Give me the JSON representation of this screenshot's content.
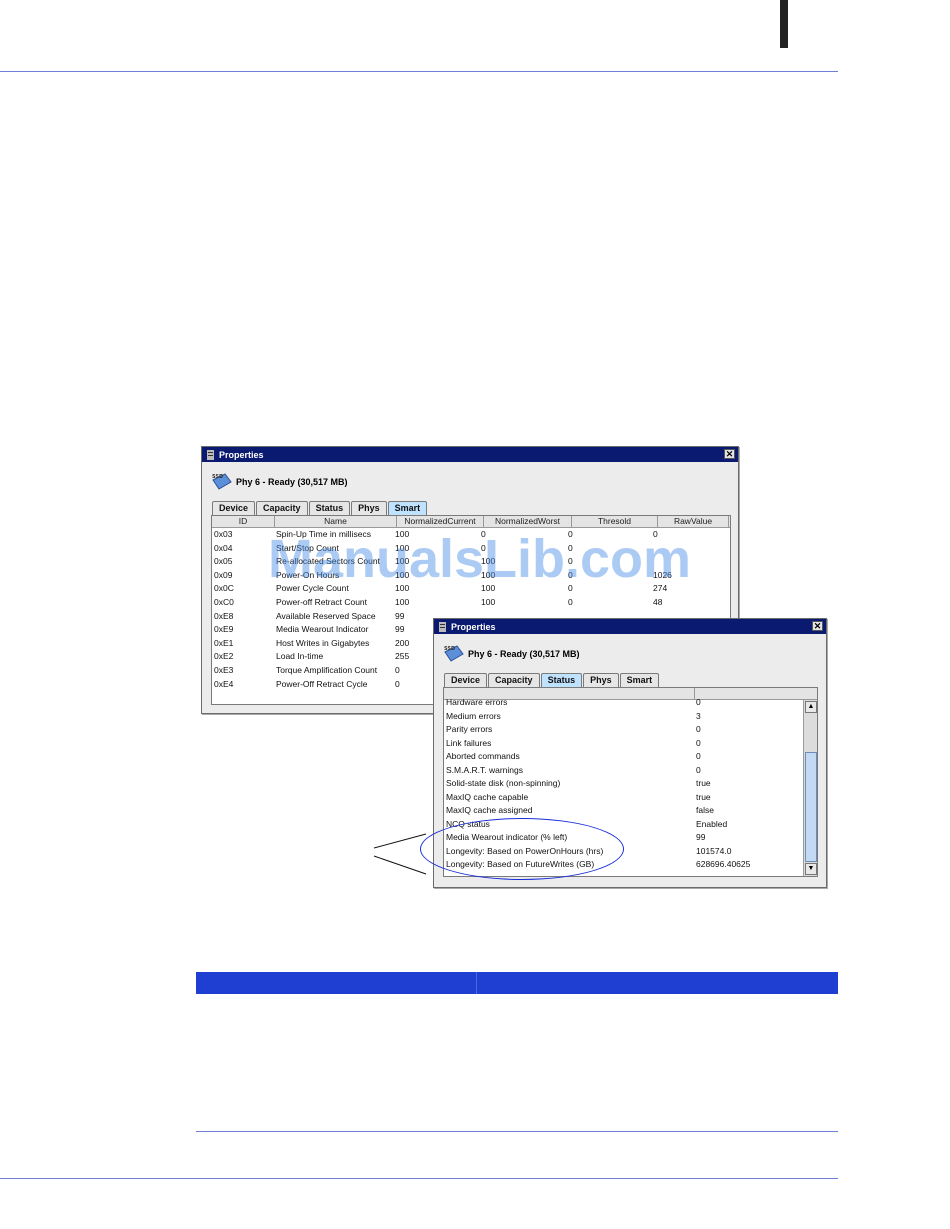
{
  "page": {
    "watermark": "ManualsLib.com"
  },
  "window1": {
    "title": "Properties",
    "close_glyph": "✕",
    "device_label": "Phy 6 - Ready (30,517 MB)",
    "tabs": [
      {
        "label": "Device",
        "active": false
      },
      {
        "label": "Capacity",
        "active": false
      },
      {
        "label": "Status",
        "active": false
      },
      {
        "label": "Phys",
        "active": false
      },
      {
        "label": "Smart",
        "active": true
      }
    ],
    "columns": [
      "ID",
      "Name",
      "NormalizedCurrent",
      "NormalizedWorst",
      "Thresold",
      "RawValue"
    ],
    "rows": [
      [
        "0x03",
        "Spin-Up Time in millisecs",
        "100",
        "0",
        "0",
        "0"
      ],
      [
        "0x04",
        "Start/Stop Count",
        "100",
        "0",
        "0",
        ""
      ],
      [
        "0x05",
        "Re-allocated Sectors Count",
        "100",
        "100",
        "0",
        ""
      ],
      [
        "0x09",
        "Power-On Hours",
        "100",
        "100",
        "0",
        "1026"
      ],
      [
        "0x0C",
        "Power Cycle Count",
        "100",
        "100",
        "0",
        "274"
      ],
      [
        "0xC0",
        "Power-off Retract Count",
        "100",
        "100",
        "0",
        "48"
      ],
      [
        "0xE8",
        "Available Reserved Space",
        "99",
        "",
        "",
        ""
      ],
      [
        "0xE9",
        "Media Wearout Indicator",
        "99",
        "",
        "",
        ""
      ],
      [
        "0xE1",
        "Host Writes in Gigabytes",
        "200",
        "",
        "",
        ""
      ],
      [
        "0xE2",
        "Load In-time",
        "255",
        "",
        "",
        ""
      ],
      [
        "0xE3",
        "Torque Amplification Count",
        "0",
        "",
        "",
        ""
      ],
      [
        "0xE4",
        "Power-Off Retract Cycle",
        "0",
        "",
        "",
        ""
      ]
    ]
  },
  "window2": {
    "title": "Properties",
    "close_glyph": "✕",
    "device_label": "Phy 6 - Ready (30,517 MB)",
    "tabs": [
      {
        "label": "Device",
        "active": false
      },
      {
        "label": "Capacity",
        "active": false
      },
      {
        "label": "Status",
        "active": true
      },
      {
        "label": "Phys",
        "active": false
      },
      {
        "label": "Smart",
        "active": false
      }
    ],
    "scroll_up": "▲",
    "scroll_down": "▼",
    "rows": [
      [
        "Hardware errors",
        "0"
      ],
      [
        "Medium errors",
        "3"
      ],
      [
        "Parity errors",
        "0"
      ],
      [
        "Link failures",
        "0"
      ],
      [
        "Aborted commands",
        "0"
      ],
      [
        "S.M.A.R.T. warnings",
        "0"
      ],
      [
        "Solid-state disk (non-spinning)",
        "true"
      ],
      [
        "MaxIQ cache capable",
        "true"
      ],
      [
        "MaxIQ cache assigned",
        "false"
      ],
      [
        "NCQ status",
        "Enabled"
      ],
      [
        "Media Wearout indicator (% left)",
        "99"
      ],
      [
        "Longevity: Based on PowerOnHours (hrs)",
        "101574.0"
      ],
      [
        "Longevity: Based on FutureWrites (GB)",
        "628696.40625"
      ]
    ]
  },
  "colors": {
    "rule": "#6f7fd8",
    "title_bar": "#0a1a70",
    "highlight_ellipse": "#1a2fd8",
    "table_header": "#1f3fd2"
  }
}
